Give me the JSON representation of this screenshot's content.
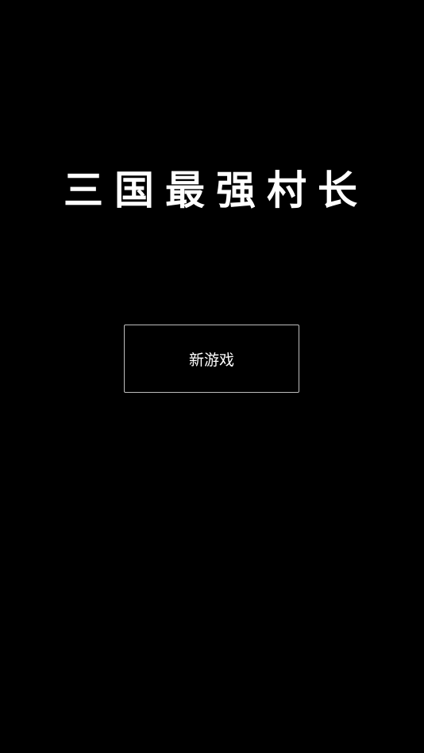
{
  "game": {
    "title": "三国最强村长"
  },
  "menu": {
    "new_game_label": "新游戏"
  },
  "colors": {
    "background": "#000000",
    "text": "#ffffff",
    "button_border": "#bdbdbd"
  }
}
